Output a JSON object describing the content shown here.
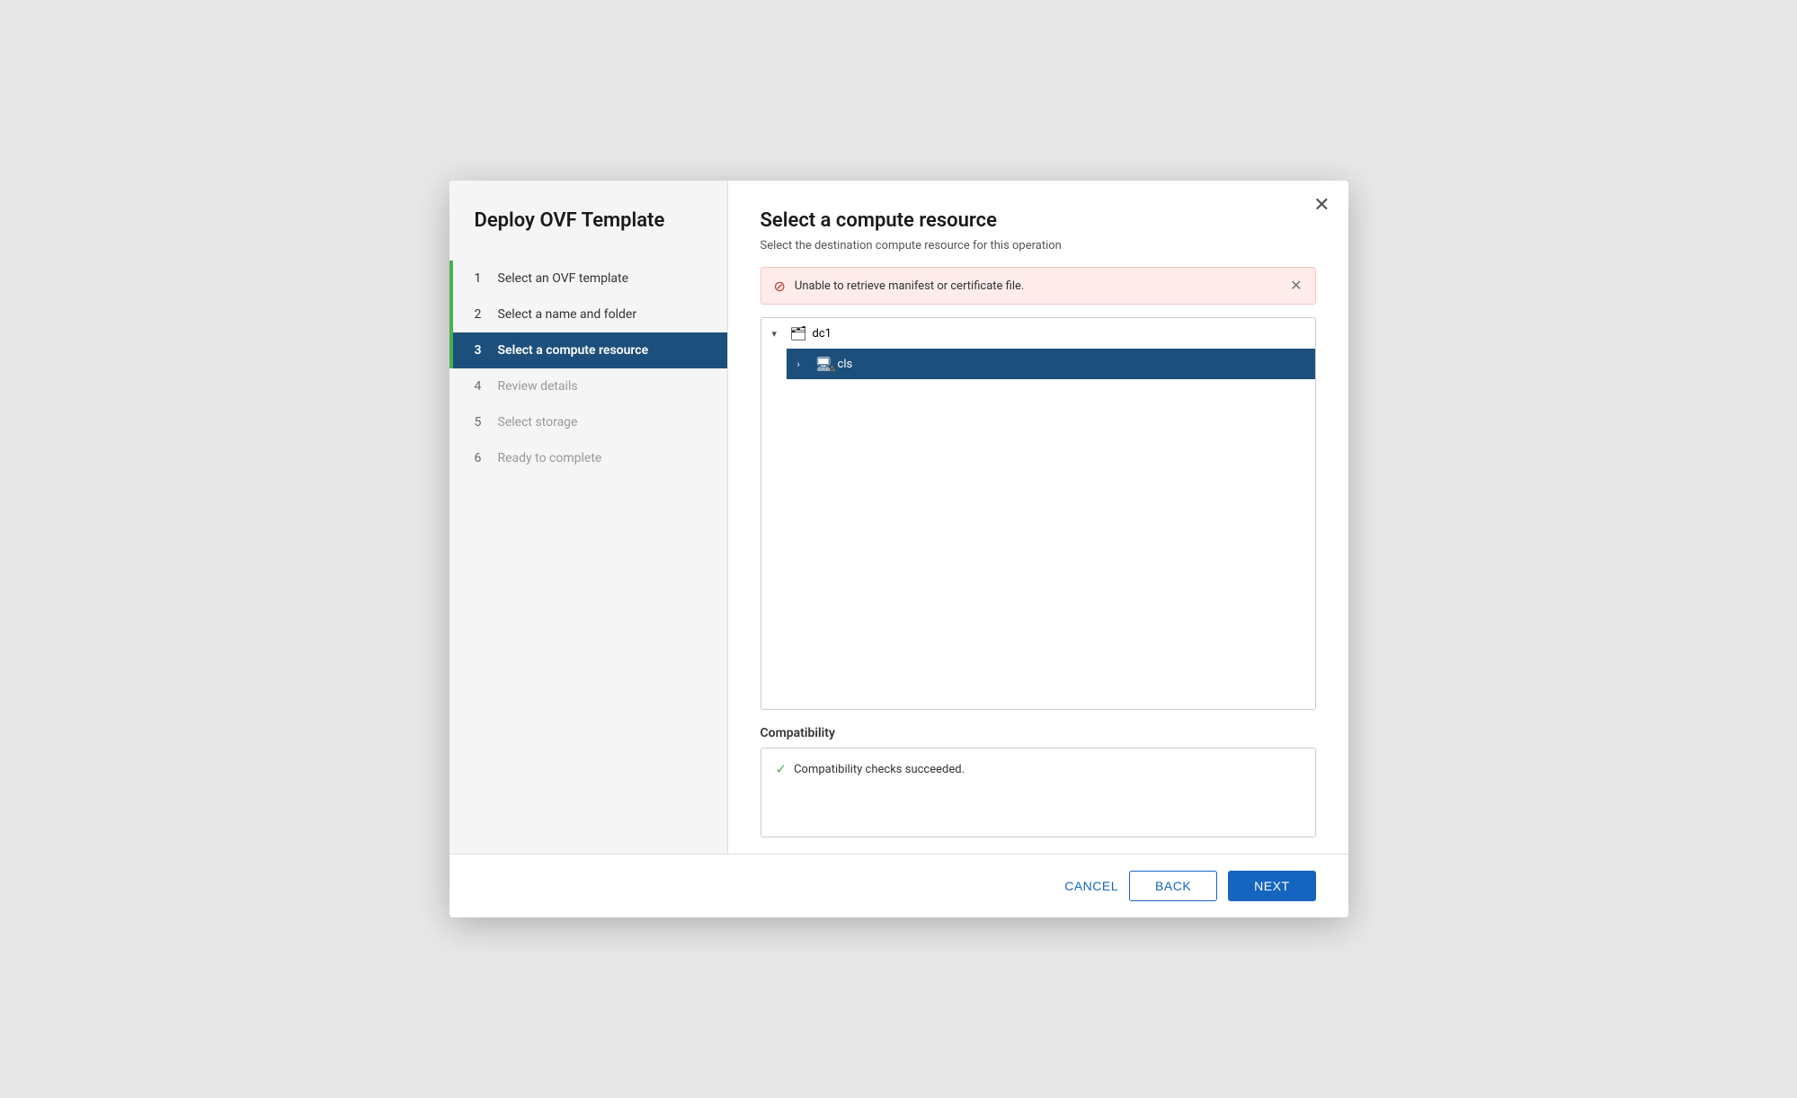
{
  "modal": {
    "sidebar_title": "Deploy OVF Template",
    "close_label": "✕",
    "steps": [
      {
        "number": "1",
        "label": "Select an OVF template",
        "state": "completed"
      },
      {
        "number": "2",
        "label": "Select a name and folder",
        "state": "completed"
      },
      {
        "number": "3",
        "label": "Select a compute resource",
        "state": "active"
      },
      {
        "number": "4",
        "label": "Review details",
        "state": "inactive"
      },
      {
        "number": "5",
        "label": "Select storage",
        "state": "inactive"
      },
      {
        "number": "6",
        "label": "Ready to complete",
        "state": "inactive"
      }
    ],
    "main_title": "Select a compute resource",
    "main_subtitle": "Select the destination compute resource for this operation",
    "error_banner": {
      "message": "Unable to retrieve manifest or certificate file.",
      "icon": "⊘"
    },
    "tree": {
      "nodes": [
        {
          "label": "dc1",
          "expanded": true,
          "icon": "datacenter",
          "children": [
            {
              "label": "cls",
              "expanded": false,
              "icon": "cluster",
              "selected": true,
              "children": []
            }
          ]
        }
      ]
    },
    "compatibility": {
      "label": "Compatibility",
      "success_text": "Compatibility checks succeeded.",
      "check_icon": "✓"
    },
    "footer": {
      "cancel_label": "CANCEL",
      "back_label": "BACK",
      "next_label": "NEXT"
    }
  }
}
